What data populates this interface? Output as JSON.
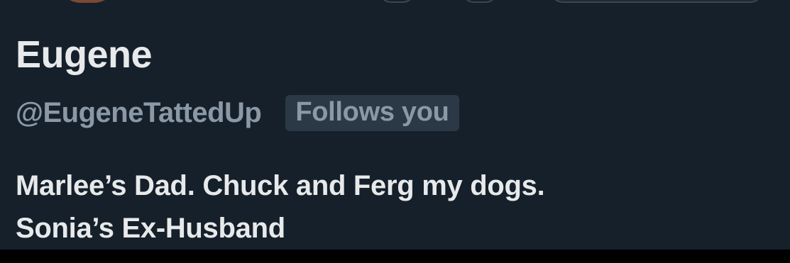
{
  "profile": {
    "display_name": "Eugene",
    "handle": "@EugeneTattedUp",
    "follows_you_label": "Follows you",
    "bio_lines": [
      "Marlee’s Dad. Chuck and Ferg my dogs.",
      "Sonia’s Ex-Husband"
    ]
  },
  "colors": {
    "background": "#15202b",
    "primary_text": "#e7e9ea",
    "secondary_text": "#8b98a5",
    "badge_background": "#2b3845"
  }
}
